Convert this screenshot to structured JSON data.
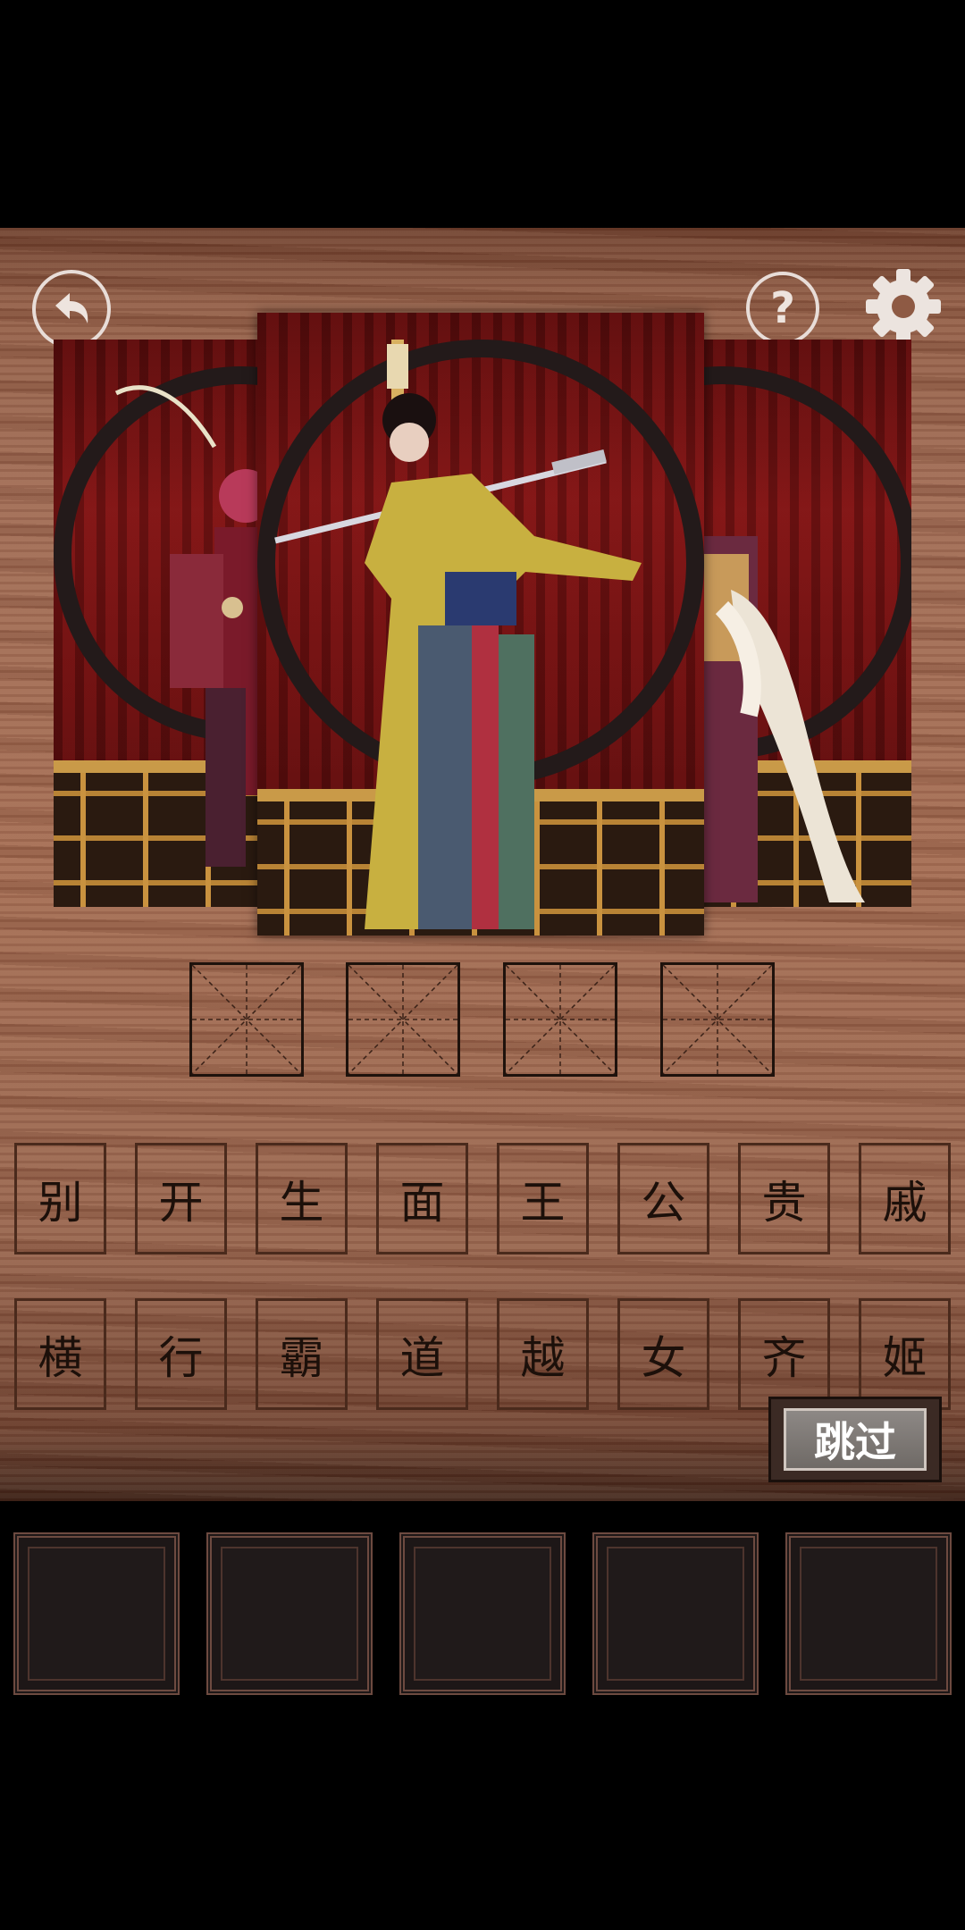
{
  "top_bar": {
    "back_icon": "back-arrow-icon",
    "hint_icon": "question-mark-icon",
    "hint_label": "提示",
    "settings_icon": "gear-icon"
  },
  "scenes": {
    "left_card": "opera-warrior",
    "center_card": "opera-swordswoman",
    "right_card": "opera-sleeve-dancer"
  },
  "answer_slots": [
    "",
    "",
    "",
    ""
  ],
  "character_tiles": {
    "row1": [
      "别",
      "开",
      "生",
      "面",
      "王",
      "公",
      "贵",
      "戚"
    ],
    "row2": [
      "横",
      "行",
      "霸",
      "道",
      "越",
      "女",
      "齐",
      "姬"
    ]
  },
  "skip_button": {
    "label": "跳过"
  },
  "bottom_slots": [
    "",
    "",
    "",
    "",
    ""
  ]
}
